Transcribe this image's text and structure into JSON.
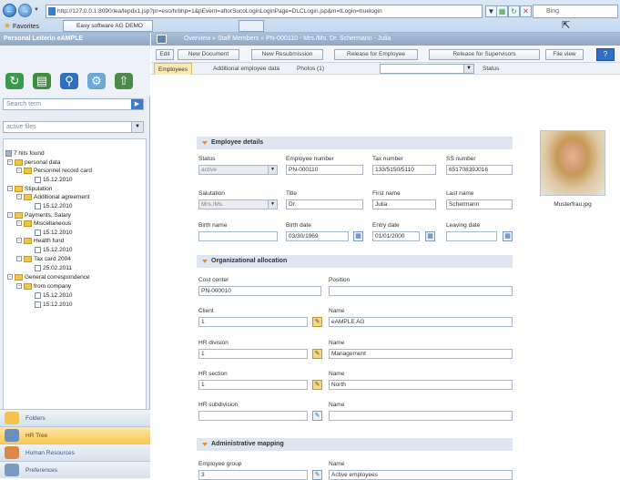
{
  "browser": {
    "address": "http://127.0.0.1:8090/lea/lepdx1.jsp?pr=eso/hrbhp=1&pEvent=aftorSucoLoginLoginPage=DLCLogin.jsp&m=tLogin=truelogin",
    "address_host": "127.0.0.1",
    "search_placeholder": "Bing",
    "favorites_label": "Favorites",
    "tab_label": "Easy software AG DEMO"
  },
  "left": {
    "header": "Personal Leiterin eAMPLE",
    "search_placeholder": "Search term",
    "filter_value": "active files",
    "tree": [
      {
        "label": "7 hits found",
        "type": "root"
      },
      {
        "label": "personal data",
        "type": "folder"
      },
      {
        "label": "Personnel record card",
        "type": "folder"
      },
      {
        "label": "15.12.2010",
        "type": "doc"
      },
      {
        "label": "Stipulation",
        "type": "folder"
      },
      {
        "label": "Additional agreement",
        "type": "folder"
      },
      {
        "label": "15.12.2010",
        "type": "doc"
      },
      {
        "label": "Payments, Salary",
        "type": "folder"
      },
      {
        "label": "Miscellaneous",
        "type": "folder"
      },
      {
        "label": "15.12.2010",
        "type": "doc"
      },
      {
        "label": "Health fund",
        "type": "folder"
      },
      {
        "label": "15.12.2010",
        "type": "doc"
      },
      {
        "label": "Tax card 2004",
        "type": "folder"
      },
      {
        "label": "25.02.2011",
        "type": "doc"
      },
      {
        "label": "General correspondence",
        "type": "folder"
      },
      {
        "label": "from company",
        "type": "folder"
      },
      {
        "label": "15.12.2010",
        "type": "doc"
      },
      {
        "label": "15.12.2010",
        "type": "doc"
      }
    ],
    "accordion": [
      {
        "label": "Folders"
      },
      {
        "label": "HR Tree"
      },
      {
        "label": "Human Resources"
      },
      {
        "label": "Preferences"
      }
    ]
  },
  "main": {
    "breadcrumb": "Overview » Staff Members » PN-000110 - Mrs./Ms. Dr. Schermann - Julia",
    "toolbar": {
      "edit": "Edit",
      "new_document": "New Document",
      "new_resubmission": "New Resubmission",
      "release_employee": "Release for Employee",
      "release_supervisors": "Release for Supervisors",
      "file_view": "File view",
      "help": "?"
    },
    "tabs": {
      "employees": "Employees",
      "additional": "Additional employee data",
      "photos": "Photos (1)",
      "status": "Status"
    },
    "employee_details": {
      "title": "Employee details",
      "status_label": "Status",
      "status_value": "active",
      "employee_number_label": "Employee number",
      "employee_number_value": "PN-000110",
      "tax_number_label": "Tax number",
      "tax_number_value": "133/5150/5110",
      "ss_number_label": "SS number",
      "ss_number_value": "65170839J016",
      "salutation_label": "Salutation",
      "salutation_value": "Mrs./Ms.",
      "title_label": "Title",
      "title_value": "Dr.",
      "first_name_label": "First name",
      "first_name_value": "Julia",
      "last_name_label": "Last name",
      "last_name_value": "Schermann",
      "birth_name_label": "Birth name",
      "birth_name_value": "",
      "birth_date_label": "Birth date",
      "birth_date_value": "03/30/1969",
      "entry_date_label": "Entry date",
      "entry_date_value": "01/01/2000",
      "leaving_date_label": "Leaving date",
      "leaving_date_value": ""
    },
    "photo_caption": "Musterfrau.jpg",
    "org_allocation": {
      "title": "Organizational allocation",
      "cost_center_label": "Cost center",
      "cost_center_value": "PN-000010",
      "position_label": "Position",
      "position_value": "",
      "client_label": "Client",
      "client_value": "1",
      "client_name_label": "Name",
      "client_name_value": "eAMPLE AG",
      "hr_division_label": "HR division",
      "hr_division_value": "1",
      "hr_division_name_label": "Name",
      "hr_division_name_value": "Management",
      "hr_section_label": "HR section",
      "hr_section_value": "1",
      "hr_section_name_label": "Name",
      "hr_section_name_value": "North",
      "hr_subdivision_label": "HR subdivision",
      "hr_subdivision_value": "",
      "hr_subdivision_name_label": "Name",
      "hr_subdivision_name_value": ""
    },
    "admin_mapping": {
      "title": "Administrative mapping",
      "employee_group_label": "Employee group",
      "employee_group_value": "3",
      "employee_group_name_label": "Name",
      "employee_group_name_value": "Active employees"
    }
  }
}
